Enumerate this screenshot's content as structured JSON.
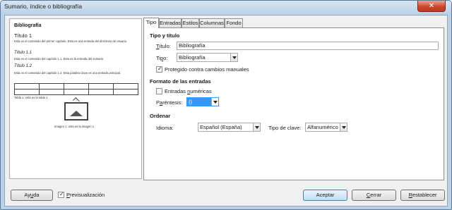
{
  "window": {
    "title": "Sumario, índice o bibliografía",
    "close_glyph": "✕"
  },
  "preview": {
    "title": "Bibliografía",
    "heading1": "Título 1",
    "text1": "Esta es el contenido del primer capítulo. Esta es una entrada del directorio de usuario.",
    "heading11": "Título 1.1",
    "text11": "Esta es el contenido del capítulo 1.1. Esta es la entrada del sumario.",
    "heading12": "Título 1.2",
    "text12": "Esta es el contenido del capítulo 1.2. Esta palabra clave es una entrada principal.",
    "table_caption": "Tabla 1: esta es la tabla 1",
    "image_caption": "Imagen 1: esta es la imagen 1"
  },
  "tabs": [
    {
      "label": "Tipo",
      "active": true
    },
    {
      "label": "Entradas",
      "active": false
    },
    {
      "label": "Estilos",
      "active": false
    },
    {
      "label": "Columnas",
      "active": false
    },
    {
      "label": "Fondo",
      "active": false
    }
  ],
  "tipo_titulo": {
    "section_label": "Tipo y título",
    "titulo_label": "Título:",
    "titulo_mnemonic": "T",
    "titulo_rest": "ítulo:",
    "titulo_value": "Bibliografía",
    "tipo_label": "Tipo:",
    "tipo_mnemonic": "p",
    "tipo_pre": "Ti",
    "tipo_rest": "o:",
    "tipo_value": "Bibliografía",
    "protegido_label": "Protegido contra cambios manuales",
    "protegido_checked": true
  },
  "formato": {
    "section_label": "Formato de las entradas",
    "numericas_label": "Entradas numéricas",
    "numericas_pre": "Entradas ",
    "numericas_mnemonic": "n",
    "numericas_rest": "uméricas",
    "numericas_checked": false,
    "parentesis_label": "Paréntesis:",
    "parentesis_pre": "P",
    "parentesis_mnemonic": "a",
    "parentesis_rest": "réntesis:",
    "parentesis_value": "()"
  },
  "ordenar": {
    "section_label": "Ordenar",
    "idioma_label": "Idioma:",
    "idioma_value": "Español (España)",
    "tipo_clave_label": "Tipo de clave:",
    "tipo_clave_value": "Alfanumérico"
  },
  "footer": {
    "ayuda_pre": "Ay",
    "ayuda_mnemonic": "u",
    "ayuda_rest": "da",
    "preview_pre": "",
    "preview_mnemonic": "P",
    "preview_rest": "revisualización",
    "preview_checked": true,
    "aceptar": "Aceptar",
    "cerrar_mnemonic": "C",
    "cerrar_rest": "errar",
    "restablecer_mnemonic": "R",
    "restablecer_rest": "establecer"
  }
}
